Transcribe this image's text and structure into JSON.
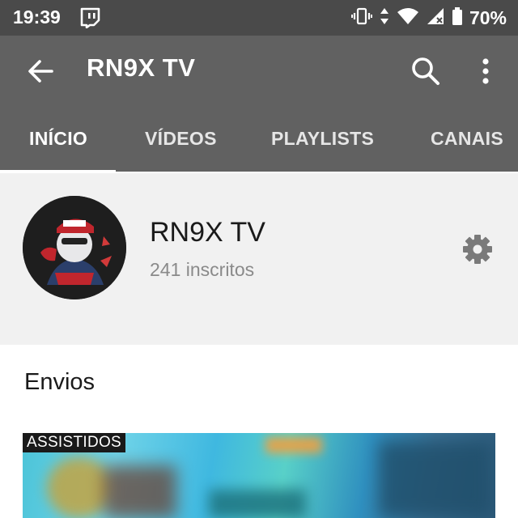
{
  "status_bar": {
    "time": "19:39",
    "battery": "70%",
    "icons": [
      "twitch-icon",
      "vibrate-icon",
      "data-arrows-icon",
      "wifi-icon",
      "signal-icon",
      "battery-icon"
    ]
  },
  "app_bar": {
    "title": "RN9X TV",
    "icons": [
      "back-arrow-icon",
      "search-icon",
      "more-vert-icon"
    ],
    "background": "#616161"
  },
  "tabs": [
    {
      "label": "INÍCIO",
      "active": true
    },
    {
      "label": "VÍDEOS",
      "active": false
    },
    {
      "label": "PLAYLISTS",
      "active": false
    },
    {
      "label": "CANAIS",
      "active": false
    }
  ],
  "channel": {
    "name": "RN9X TV",
    "subscribers": "241 inscritos",
    "settings_icon": "gear-icon"
  },
  "uploads": {
    "section_title": "Envios",
    "videos": [
      {
        "badge": "ASSISTIDOS"
      }
    ]
  }
}
